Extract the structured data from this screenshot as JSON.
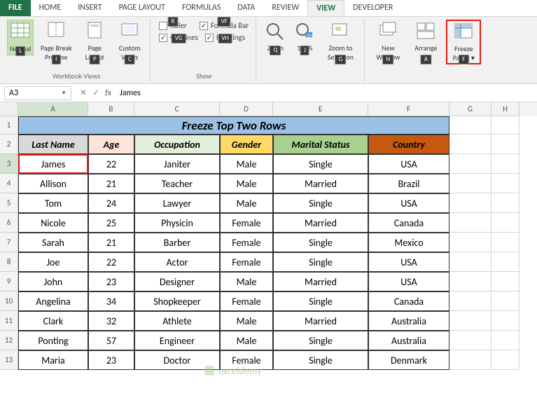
{
  "tabs": [
    "FILE",
    "HOME",
    "INSERT",
    "PAGE LAYOUT",
    "FORMULAS",
    "DATA",
    "REVIEW",
    "VIEW",
    "DEVELOPER"
  ],
  "active_tab": "VIEW",
  "ribbon": {
    "views": {
      "normal": "Normal",
      "page_break": "Page Break Preview",
      "page_layout": "Page Layout",
      "custom": "Custom Views",
      "group_label": "Workbook Views",
      "k_normal": "L",
      "k_pb": "I",
      "k_pl": "P",
      "k_cv": "C"
    },
    "show": {
      "ruler": "Ruler",
      "gridlines": "Gridlines",
      "formula_bar": "Formula Bar",
      "headings": "Headings",
      "group_label": "Show",
      "k_r": "R",
      "k_vg": "VG",
      "k_vf": "VF",
      "k_vh": "VH"
    },
    "zoom": {
      "zoom": "Zoom",
      "hundred": "100%",
      "to_sel": "Zoom to Selection",
      "k_q": "Q",
      "k_j": "J",
      "k_g": "G"
    },
    "window": {
      "new": "New Window",
      "arrange": "Arrange All",
      "freeze": "Freeze Panes",
      "k_n": "N",
      "k_a": "A",
      "k_f": "F"
    }
  },
  "namebox": "A3",
  "formula": "James",
  "columns": [
    "A",
    "B",
    "C",
    "D",
    "E",
    "F",
    "G",
    "H"
  ],
  "title": "Freeze Top Two Rows",
  "headers": [
    "Last Name",
    "Age",
    "Occupation",
    "Gender",
    "Marital Status",
    "Country"
  ],
  "rows": [
    {
      "n": 3,
      "d": [
        "James",
        "22",
        "Janiter",
        "Male",
        "Single",
        "USA"
      ]
    },
    {
      "n": 4,
      "d": [
        "Allison",
        "21",
        "Teacher",
        "Male",
        "Married",
        "Brazil"
      ]
    },
    {
      "n": 5,
      "d": [
        "Tom",
        "24",
        "Lawyer",
        "Male",
        "Single",
        "USA"
      ]
    },
    {
      "n": 6,
      "d": [
        "Nicole",
        "25",
        "Physicin",
        "Female",
        "Married",
        "Canada"
      ]
    },
    {
      "n": 7,
      "d": [
        "Sarah",
        "21",
        "Barber",
        "Female",
        "Single",
        "Mexico"
      ]
    },
    {
      "n": 8,
      "d": [
        "Joe",
        "22",
        "Actor",
        "Female",
        "Single",
        "USA"
      ]
    },
    {
      "n": 9,
      "d": [
        "John",
        "23",
        "Designer",
        "Male",
        "Married",
        "USA"
      ]
    },
    {
      "n": 10,
      "d": [
        "Angelina",
        "34",
        "Shopkeeper",
        "Female",
        "Single",
        "Canada"
      ]
    },
    {
      "n": 11,
      "d": [
        "Clark",
        "32",
        "Athlete",
        "Male",
        "Married",
        "Australia"
      ]
    },
    {
      "n": 12,
      "d": [
        "Ponting",
        "57",
        "Engineer",
        "Male",
        "Single",
        "Australia"
      ]
    },
    {
      "n": 13,
      "d": [
        "Maria",
        "23",
        "Doctor",
        "Female",
        "Single",
        "Denmark"
      ]
    }
  ],
  "watermark": "exceldemy"
}
